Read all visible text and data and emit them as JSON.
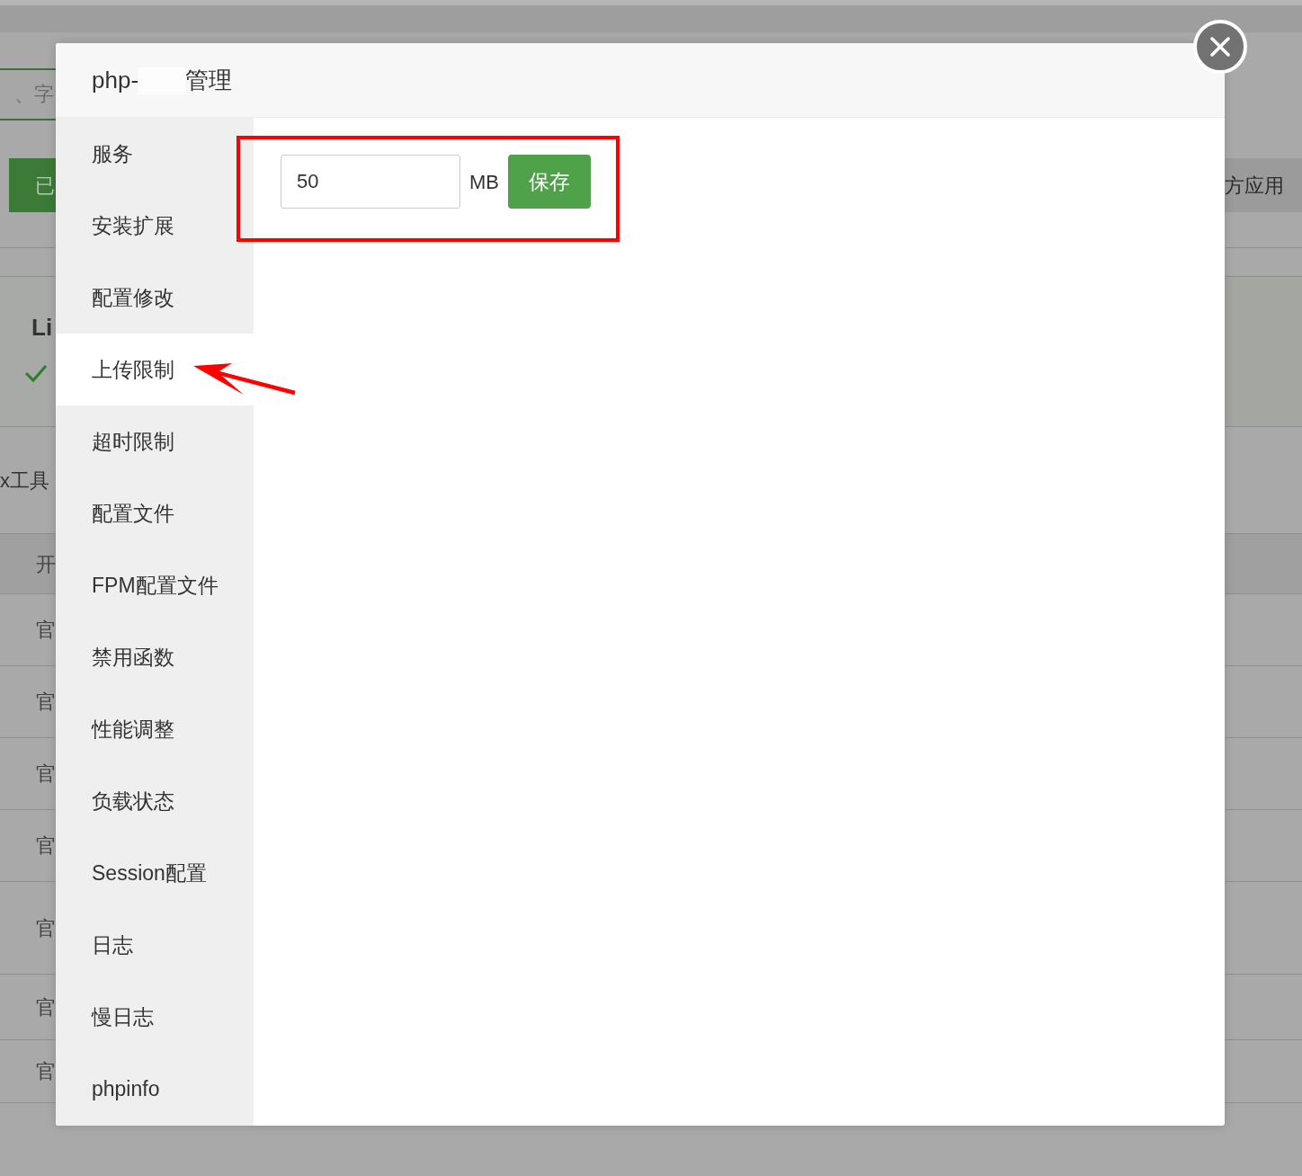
{
  "background": {
    "search": {
      "placeholder": "、字"
    },
    "button": "已",
    "tab": "方应用",
    "panel_title": "Li",
    "section_title": "x工具",
    "table": {
      "header": "开",
      "rows": [
        "官",
        "官",
        "官",
        "官",
        "官",
        "官",
        "官"
      ]
    }
  },
  "dialog": {
    "title": {
      "prefix": "php-",
      "suffix": "管理",
      "redacted": true
    },
    "menu": [
      {
        "label": "服务",
        "selected": false,
        "arrow": false
      },
      {
        "label": "安装扩展",
        "selected": false,
        "arrow": false
      },
      {
        "label": "配置修改",
        "selected": false,
        "arrow": false
      },
      {
        "label": "上传限制",
        "selected": true,
        "arrow": true
      },
      {
        "label": "超时限制",
        "selected": false,
        "arrow": false
      },
      {
        "label": "配置文件",
        "selected": false,
        "arrow": false
      },
      {
        "label": "FPM配置文件",
        "selected": false,
        "arrow": false
      },
      {
        "label": "禁用函数",
        "selected": false,
        "arrow": false
      },
      {
        "label": "性能调整",
        "selected": false,
        "arrow": false
      },
      {
        "label": "负载状态",
        "selected": false,
        "arrow": false
      },
      {
        "label": "Session配置",
        "selected": false,
        "arrow": false
      },
      {
        "label": "日志",
        "selected": false,
        "arrow": false
      },
      {
        "label": "慢日志",
        "selected": false,
        "arrow": false
      },
      {
        "label": "phpinfo",
        "selected": false,
        "arrow": false
      }
    ],
    "upload_limit": {
      "value": "50",
      "unit": "MB",
      "button": "保存",
      "framed": true
    }
  }
}
